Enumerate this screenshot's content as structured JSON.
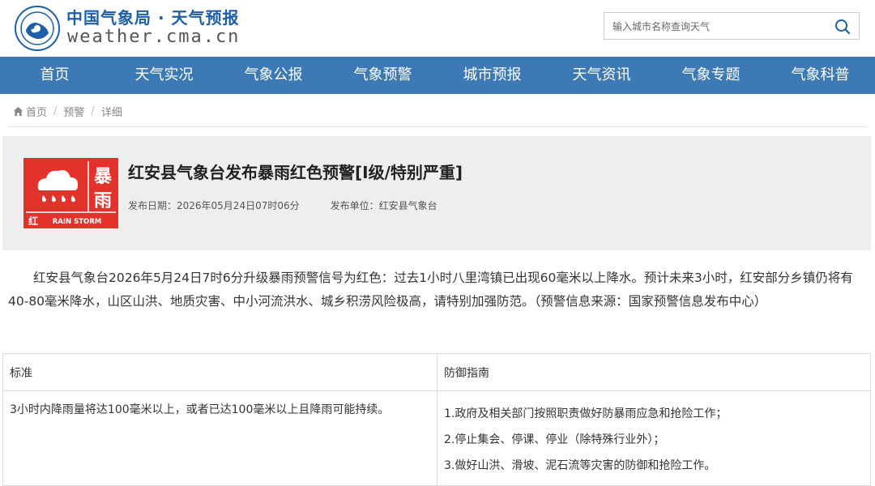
{
  "header": {
    "brand_cn": "中国气象局 · 天气预报",
    "brand_en": "weather.cma.cn",
    "search_placeholder": "输入城市名称查询天气",
    "logo_icon": "cma-emblem-icon",
    "search_icon": "magnifier-icon"
  },
  "nav": {
    "items": [
      "首页",
      "天气实况",
      "气象公报",
      "气象预警",
      "城市预报",
      "天气资讯",
      "气象专题",
      "气象科普"
    ]
  },
  "breadcrumb": {
    "home_icon": "house-icon",
    "items": [
      "首页",
      "预警",
      "详细"
    ]
  },
  "alert": {
    "title": "红安县气象台发布暴雨红色预警[I级/特别严重]",
    "date_label": "发布日期：2026年05月24日07时06分",
    "unit_label": "发布单位：红安县气象台",
    "icon": {
      "name": "rainstorm-red-warning-icon",
      "char1": "暴",
      "char2": "雨",
      "level_char": "红",
      "en_text": "RAIN STORM",
      "color": "#e3312b"
    }
  },
  "content": {
    "paragraph": "红安县气象台2026年5月24日7时6分升级暴雨预警信号为红色：过去1小时八里湾镇已出现60毫米以上降水。预计未来3小时，红安部分乡镇仍将有40-80毫米降水，山区山洪、地质灾害、中小河流洪水、城乡积涝风险极高，请特别加强防范。（预警信息来源：国家预警信息发布中心）"
  },
  "table": {
    "header_standard": "标准",
    "header_guide": "防御指南",
    "standard_text": "3小时内降雨量将达100毫米以上，或者已达100毫米以上且降雨可能持续。",
    "guide_items": [
      "1.政府及相关部门按照职责做好防暴雨应急和抢险工作；",
      "2.停止集会、停课、停业（除特殊行业外）；",
      "3.做好山洪、滑坡、泥石流等灾害的防御和抢险工作。"
    ]
  },
  "colors": {
    "nav_bg": "#3d79b5",
    "brand_blue": "#1f5fa6",
    "alert_bg": "#eeeeee",
    "warning_red": "#e3312b"
  }
}
